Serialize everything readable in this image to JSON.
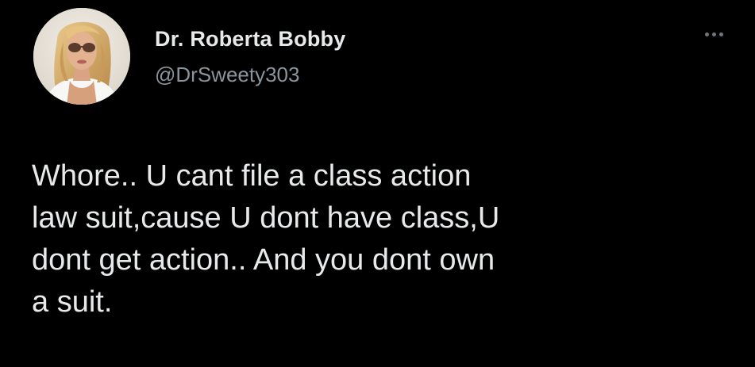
{
  "tweet": {
    "author": {
      "display_name": "Dr. Roberta Bobby",
      "handle": "@DrSweety303",
      "avatar_icon": "profile-photo"
    },
    "text_lines": [
      "Whore.. U cant file a class action",
      "law suit,cause U dont have class,U",
      "dont get action.. And you dont own",
      "a suit."
    ],
    "more_icon": "more-options-icon"
  },
  "colors": {
    "background": "#000000",
    "primary_text": "#e7e9ea",
    "secondary_text": "#8b949b",
    "icon": "#6e767d"
  }
}
